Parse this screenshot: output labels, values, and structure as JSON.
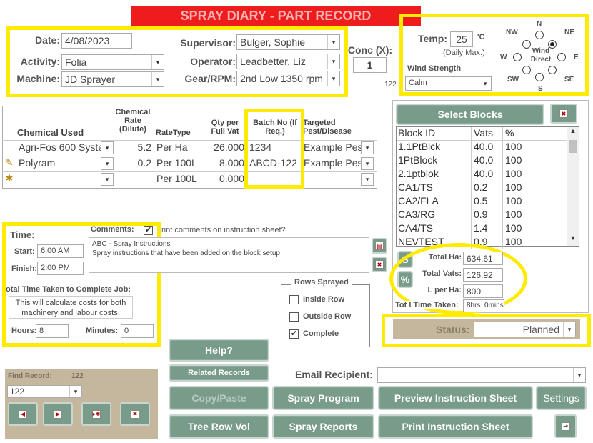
{
  "title": "SPRAY DIARY - PART RECORD",
  "colors": {
    "title_bg": "#ee1c1c",
    "highlight": "#ffeb00",
    "button": "#789b8a",
    "status_bg": "#c4b79d"
  },
  "header": {
    "date_label": "Date:",
    "date_value": "4/08/2023",
    "activity_label": "Activity:",
    "activity_value": "Folia",
    "machine_label": "Machine:",
    "machine_value": "JD Sprayer",
    "supervisor_label": "Supervisor:",
    "supervisor_value": "Bulger, Sophie",
    "operator_label": "Operator:",
    "operator_value": "Leadbetter, Liz",
    "gear_label": "Gear/RPM:",
    "gear_value": "2nd Low 1350 rpm",
    "conc_label": "Conc (X):",
    "conc_value": "1",
    "record_number": "122"
  },
  "weather": {
    "temp_label": "Temp:",
    "temp_value": "25",
    "temp_unit": "'C",
    "temp_note": "(Daily Max.)",
    "wind_strength_label": "Wind Strength",
    "wind_strength_value": "Calm",
    "wind_direct_label": "Wind Direct",
    "compass": {
      "n": "N",
      "ne": "NE",
      "e": "E",
      "se": "SE",
      "s": "S",
      "sw": "SW",
      "w": "W",
      "nw": "NW"
    },
    "selected_direction": "NE"
  },
  "chemicals": {
    "headers": {
      "chemical": "Chemical Used",
      "rate": "Chemical Rate (Dilute)",
      "rate_type": "RateType",
      "qty": "Qty per Full Vat",
      "batch": "Batch No  (If Req.)",
      "target": "Targeted Pest/Disease"
    },
    "rows": [
      {
        "marker": "",
        "chemical": "Agri-Fos 600 Syste",
        "rate": "5.2",
        "rate_type": "Per Ha",
        "qty": "26.000",
        "batch": "1234",
        "target": "Example Pes"
      },
      {
        "marker": "✎",
        "chemical": "Polyram",
        "rate": "0.2",
        "rate_type": "Per 100L",
        "qty": "8.000",
        "batch": "ABCD-122",
        "target": "Example Pes"
      },
      {
        "marker": "✱",
        "chemical": "",
        "rate": "",
        "rate_type": "Per 100L",
        "qty": "0.000",
        "batch": "",
        "target": ""
      }
    ]
  },
  "time": {
    "title": "Time:",
    "start_label": "Start:",
    "start_value": "6:00 AM",
    "finish_label": "Finish:",
    "finish_value": "2:00 PM",
    "total_label": "otal Time Taken to Complete Job:",
    "note": "This will calculate costs for both machinery and labour costs.",
    "hours_label": "Hours:",
    "hours_value": "8",
    "minutes_label": "Minutes:",
    "minutes_value": "0"
  },
  "comments": {
    "label": "Comments:",
    "print_label": "rint comments on instruction sheet?",
    "print_checked": true,
    "text": "ABC - Spray Instructions\nSpray instructions that have been added on the block setup"
  },
  "rows_sprayed": {
    "title": "Rows Sprayed",
    "options": [
      {
        "label": "Inside Row",
        "checked": false
      },
      {
        "label": "Outside Row",
        "checked": false
      },
      {
        "label": "Complete",
        "checked": true
      }
    ]
  },
  "blocks": {
    "select_label": "Select Blocks",
    "headers": {
      "id": "Block ID",
      "vats": "Vats",
      "pct": "%"
    },
    "rows": [
      {
        "id": "1.1PtBlck",
        "vats": "40.0",
        "pct": "100"
      },
      {
        "id": "1PtBlock",
        "vats": "40.0",
        "pct": "100"
      },
      {
        "id": "2.1ptblok",
        "vats": "40.0",
        "pct": "100"
      },
      {
        "id": "CA1/TS",
        "vats": "0.2",
        "pct": "100"
      },
      {
        "id": "CA2/FLA",
        "vats": "0.5",
        "pct": "100"
      },
      {
        "id": "CA3/RG",
        "vats": "0.9",
        "pct": "100"
      },
      {
        "id": "CA4/TS",
        "vats": "1.4",
        "pct": "100"
      },
      {
        "id": "NEVTEST",
        "vats": "0.9",
        "pct": "100"
      }
    ]
  },
  "totals": {
    "s_label": "S",
    "pct_label": "%",
    "total_ha_label": "Total Ha:",
    "total_ha_value": "634.61",
    "total_vats_label": "Total Vats:",
    "total_vats_value": "126.92",
    "l_per_ha_label": "L per Ha:",
    "l_per_ha_value": "800",
    "total_time_label": "Tot l Time Taken:",
    "total_time_value": "8hrs. 0mins"
  },
  "status": {
    "label": "Status:",
    "value": "Planned"
  },
  "find": {
    "label": "Find Record:",
    "count": "122",
    "value": "122"
  },
  "buttons": {
    "help": "Help?",
    "related": "Related Records",
    "copy": "Copy/Paste",
    "spray_program": "Spray Program",
    "preview": "Preview Instruction Sheet",
    "settings": "Settings",
    "tree_row": "Tree Row Vol",
    "spray_reports": "Spray Reports",
    "print": "Print Instruction Sheet"
  },
  "email": {
    "label": "Email Recipient:",
    "value": ""
  }
}
